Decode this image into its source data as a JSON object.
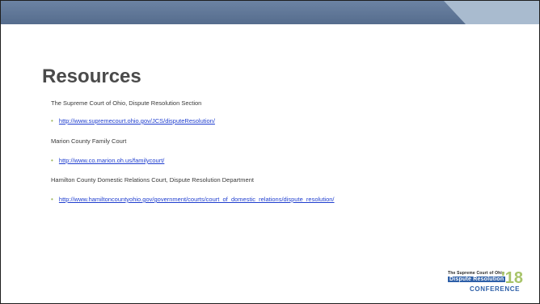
{
  "slide": {
    "title": "Resources",
    "items": [
      {
        "kind": "text",
        "text": "The Supreme Court of Ohio, Dispute Resolution Section"
      },
      {
        "kind": "link",
        "text": "http://www.supremecourt.ohio.gov/JCS/disputeResolution/"
      },
      {
        "kind": "text",
        "text": "Marion County Family Court"
      },
      {
        "kind": "link",
        "text": "http://www.co.marion.oh.us/familycourt/"
      },
      {
        "kind": "text",
        "text": "Hamilton County Domestic Relations Court, Dispute Resolution Department"
      },
      {
        "kind": "link",
        "text": "http://www.hamiltoncountyohio.gov/government/courts/court_of_domestic_relations/dispute_resolution/"
      }
    ],
    "bullet_glyph": "•"
  },
  "logo": {
    "line1": "The Supreme Court of Ohio",
    "line2": "Dispute Resolution",
    "year": "'18",
    "line3": "CONFERENCE"
  },
  "colors": {
    "band": "#5b7394",
    "band_highlight": "#9fb2c8",
    "accent": "#9bb55a",
    "title": "#4a4a4a",
    "link": "#1f3ecf",
    "border": "#1e1e1e"
  }
}
